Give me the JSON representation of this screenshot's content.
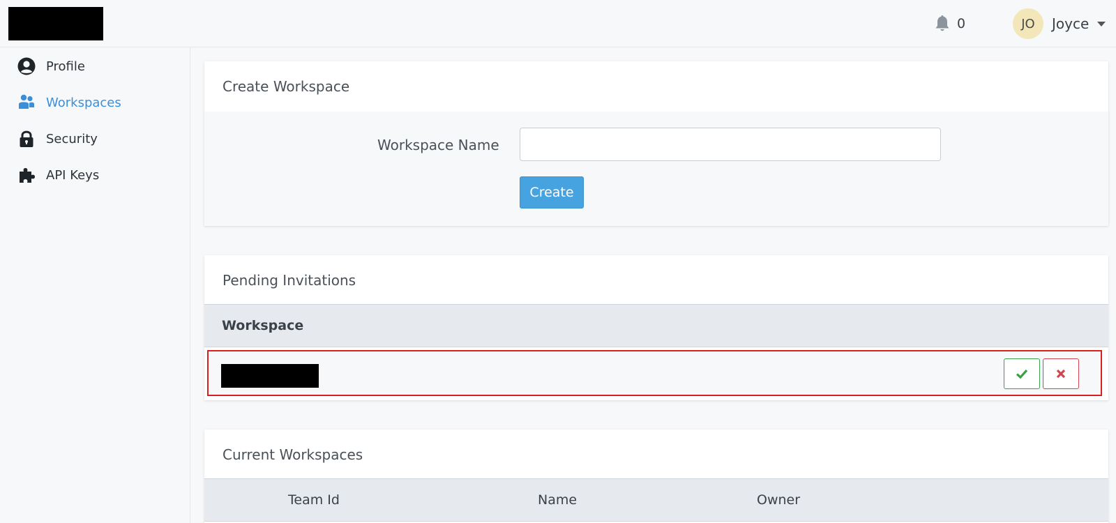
{
  "header": {
    "notification_count": "0",
    "user": {
      "initials": "JO",
      "name": "Joyce"
    }
  },
  "sidebar": {
    "items": [
      {
        "label": "Profile",
        "icon": "user-circle-icon"
      },
      {
        "label": "Workspaces",
        "icon": "users-icon",
        "active": true
      },
      {
        "label": "Security",
        "icon": "lock-icon"
      },
      {
        "label": "API Keys",
        "icon": "puzzle-icon"
      }
    ]
  },
  "create_workspace": {
    "title": "Create Workspace",
    "field_label": "Workspace Name",
    "field_value": "",
    "button_label": "Create"
  },
  "pending_invitations": {
    "title": "Pending Invitations",
    "columns": [
      "Workspace"
    ],
    "rows": [
      {
        "workspace": ""
      }
    ]
  },
  "current_workspaces": {
    "title": "Current Workspaces",
    "columns": [
      "Team Id",
      "Name",
      "Owner"
    ]
  },
  "colors": {
    "accent": "#3b8fd9",
    "primary_button": "#47a3df",
    "accept": "#3aa14a",
    "reject": "#d1434f",
    "highlight_border": "#d9201f"
  }
}
